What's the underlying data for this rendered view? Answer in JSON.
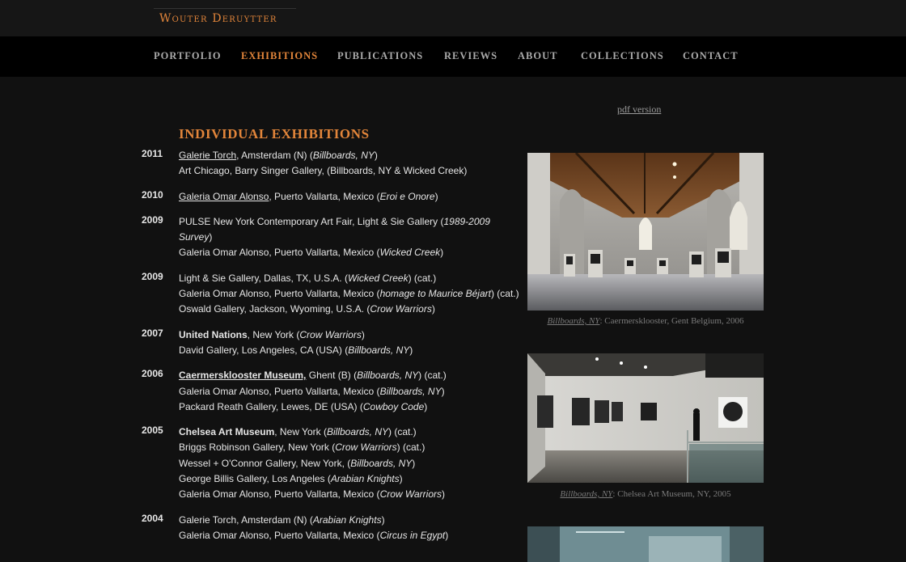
{
  "header": {
    "brand": "Wouter Deruytter"
  },
  "nav": [
    {
      "label": "PORTFOLIO",
      "active": false
    },
    {
      "label": "EXHIBITIONS",
      "active": true
    },
    {
      "label": "PUBLICATIONS",
      "active": false
    },
    {
      "label": "REVIEWS",
      "active": false
    },
    {
      "label": "ABOUT",
      "active": false
    },
    {
      "label": "COLLECTIONS",
      "active": false
    },
    {
      "label": "CONTACT",
      "active": false
    }
  ],
  "pdf_link": "pdf version",
  "section_title": "INDIVIDUAL EXHIBITIONS",
  "colors": {
    "accent": "#e2853a",
    "background": "#111111",
    "nav_background": "#000000"
  },
  "exhibitions": [
    {
      "year": "2011",
      "entries": [
        {
          "venue": "Galerie Torch",
          "style": "link",
          "rest": ", Amsterdam (N) (",
          "title": "Billboards, NY",
          "end": ")"
        },
        {
          "venue": "Art Chicago, Barry Singer Gallery, (Billboards, NY & Wicked Creek)",
          "style": "plain",
          "rest": "",
          "title": "",
          "end": ""
        }
      ]
    },
    {
      "year": "2010",
      "entries": [
        {
          "venue": "Galeria Omar Alonso",
          "style": "link",
          "rest": ", Puerto Vallarta, Mexico (",
          "title": "Eroi e Onore",
          "end": ")"
        }
      ]
    },
    {
      "year": "2009",
      "entries": [
        {
          "venue": "PULSE New York Contemporary Art Fair, Light & Sie Gallery",
          "style": "plain",
          "rest": " (",
          "title": "1989-2009 Survey",
          "end": ")"
        },
        {
          "venue": "Galeria Omar Alonso",
          "style": "plain",
          "rest": ", Puerto Vallarta, Mexico (",
          "title": "Wicked Creek",
          "end": ")"
        }
      ]
    },
    {
      "year": "2009",
      "entries": [
        {
          "venue": "Light & Sie Gallery",
          "style": "plain",
          "rest": ", Dallas, TX, U.S.A. (",
          "title": "Wicked Creek",
          "end": ") (cat.)"
        },
        {
          "venue": "Galeria Omar Alonso",
          "style": "plain",
          "rest": ", Puerto Vallarta, Mexico (",
          "title": "homage to Maurice Béjart",
          "end": ") (cat.)"
        },
        {
          "venue": "Oswald Gallery",
          "style": "plain",
          "rest": ", Jackson, Wyoming, U.S.A. (",
          "title": "Crow Warriors",
          "end": ")"
        }
      ]
    },
    {
      "year": "2007",
      "entries": [
        {
          "venue": "United Nations",
          "style": "strong",
          "rest": ", New York (",
          "title": "Crow Warriors",
          "end": ")"
        },
        {
          "venue": "David Gallery",
          "style": "plain",
          "rest": ", Los Angeles, CA (USA) (",
          "title": "Billboards, NY",
          "end": ")"
        }
      ]
    },
    {
      "year": "2006",
      "entries": [
        {
          "venue": "Caermersklooster Museum,",
          "style": "strong-link",
          "rest": " Ghent (B) (",
          "title": "Billboards, NY",
          "end": ") (cat.)"
        },
        {
          "venue": "Galeria Omar Alonso",
          "style": "plain",
          "rest": ", Puerto Vallarta, Mexico (",
          "title": "Billboards, NY",
          "end": ")"
        },
        {
          "venue": "Packard Reath Gallery",
          "style": "plain",
          "rest": ", Lewes, DE (USA) (",
          "title": "Cowboy Code",
          "end": ")"
        }
      ]
    },
    {
      "year": "2005",
      "entries": [
        {
          "venue": "Chelsea Art Museum",
          "style": "strong",
          "rest": ", New York (",
          "title": "Billboards, NY",
          "end": ") (cat.)"
        },
        {
          "venue": "Briggs Robinson Gallery",
          "style": "plain",
          "rest": ", New York (",
          "title": "Crow Warriors",
          "end": ") (cat.)"
        },
        {
          "venue": "Wessel + O'Connor Gallery",
          "style": "plain",
          "rest": ", New York, (",
          "title": "Billboards, NY",
          "end": ")"
        },
        {
          "venue": "George Billis Gallery",
          "style": "plain",
          "rest": ", Los Angeles (",
          "title": "Arabian Knights",
          "end": ")"
        },
        {
          "venue": "Galeria Omar Alonso",
          "style": "plain",
          "rest": ", Puerto Vallarta, Mexico (",
          "title": "Crow Warriors",
          "end": ")"
        }
      ]
    },
    {
      "year": "2004",
      "entries": [
        {
          "venue": "Galerie Torch",
          "style": "plain",
          "rest": ", Amsterdam (N) (",
          "title": "Arabian Knights",
          "end": ")"
        },
        {
          "venue": "Galeria Omar Alonso",
          "style": "plain",
          "rest": ", Puerto Vallarta, Mexico (",
          "title": "Circus in Egypt",
          "end": ")"
        }
      ]
    }
  ],
  "photos": [
    {
      "caption_link": "Billboards, NY",
      "caption_rest": ": Caermersklooster, Gent Belgium, 2006"
    },
    {
      "caption_link": "Billboards, NY",
      "caption_rest": ": Chelsea Art Museum, NY, 2005"
    }
  ]
}
